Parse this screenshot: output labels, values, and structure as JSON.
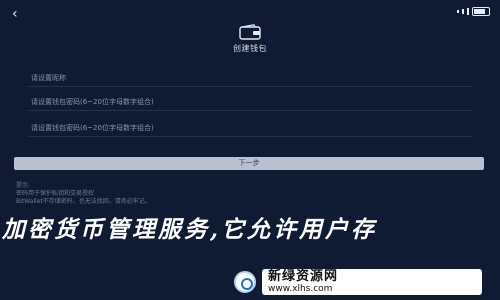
{
  "header": {
    "back_icon": "back-arrow-icon",
    "logo_icon": "wallet-icon",
    "title": "创建钱包"
  },
  "form": {
    "name_placeholder": "请设置昵称",
    "password_placeholder": "请设置钱包密码(6~20位字母数字组合)",
    "confirm_placeholder": "请设置钱包密码(6~20位字母数字组合)"
  },
  "actions": {
    "next_label": "下一步"
  },
  "notes": {
    "line1": "提示:",
    "line2": "密码用于保护私钥和交易授权",
    "line3": "BitWallet不存储密码，也无法找回，请务必牢记。"
  },
  "banner": {
    "text": "加密货币管理服务,它允许用户存"
  },
  "watermark": {
    "name": "新绿资源网",
    "url": "www.xlhs.com"
  },
  "colors": {
    "background": "#0f1a33",
    "button": "#b9c1d0"
  }
}
